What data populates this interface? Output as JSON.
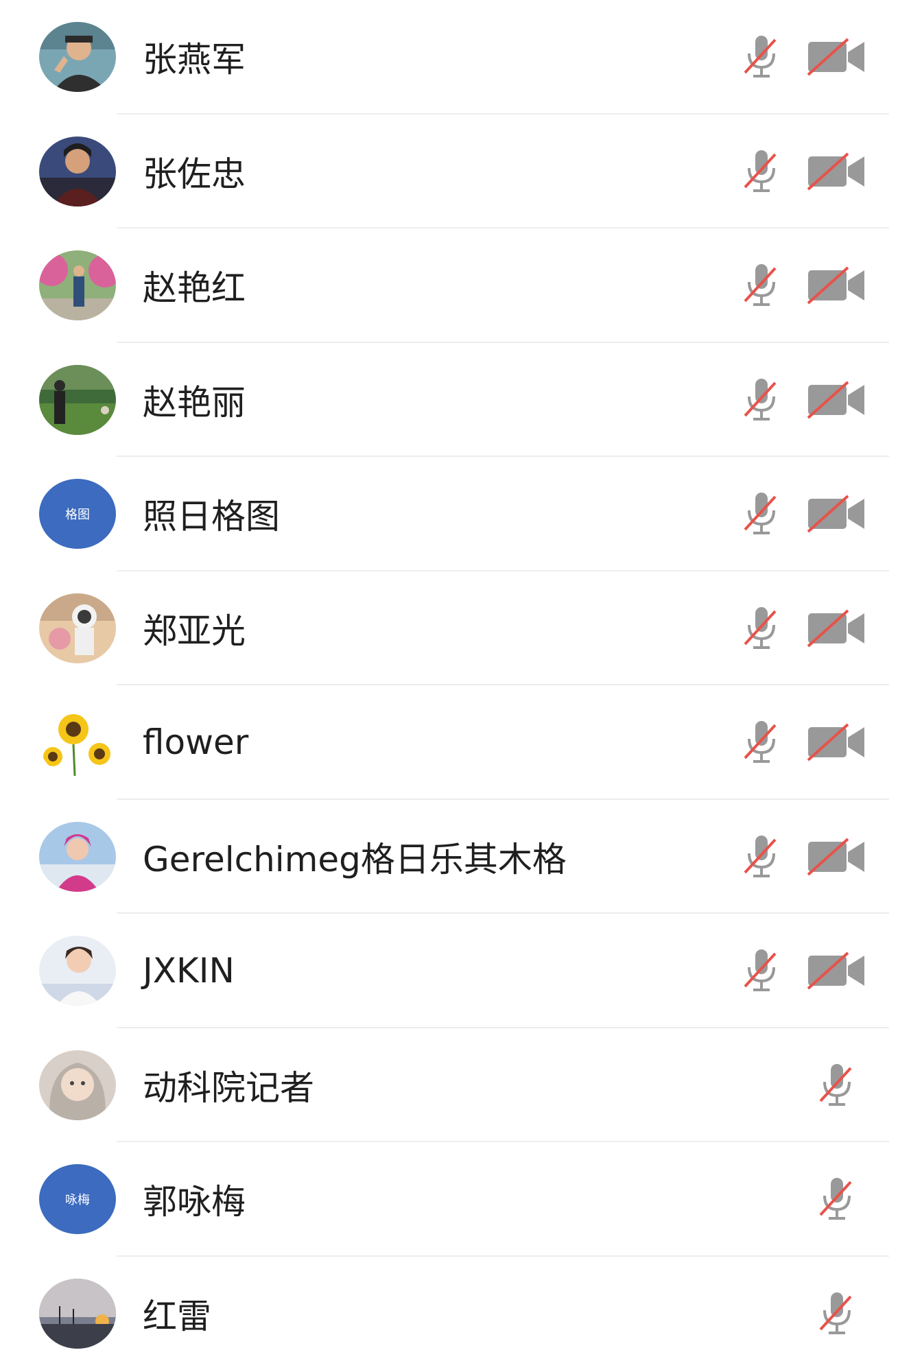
{
  "participants": [
    {
      "name": "张燕军",
      "avatar": "photo",
      "camera": true
    },
    {
      "name": "张佐忠",
      "avatar": "photo",
      "camera": true
    },
    {
      "name": "赵艳红",
      "avatar": "photo",
      "camera": true
    },
    {
      "name": "赵艳丽",
      "avatar": "photo",
      "camera": true
    },
    {
      "name": "照日格图",
      "avatar": "initials",
      "initials": "格图",
      "camera": true
    },
    {
      "name": "郑亚光",
      "avatar": "photo",
      "camera": true
    },
    {
      "name": "flower",
      "avatar": "photo",
      "camera": true
    },
    {
      "name": "Gerelchimeg格日乐其木格",
      "avatar": "photo",
      "camera": true
    },
    {
      "name": "JXKIN",
      "avatar": "photo",
      "camera": true
    },
    {
      "name": "动科院记者",
      "avatar": "photo",
      "camera": false
    },
    {
      "name": "郭咏梅",
      "avatar": "initials",
      "initials": "咏梅",
      "camera": false
    },
    {
      "name": "红雷",
      "avatar": "photo",
      "camera": false
    }
  ],
  "icons": {
    "mic": "mic-off-icon",
    "camera": "video-off-icon"
  },
  "colors": {
    "initials_avatar": "#3c6bbf",
    "icon_gray": "#999999",
    "mute_slash": "#e8524a",
    "divider": "#ededed"
  }
}
